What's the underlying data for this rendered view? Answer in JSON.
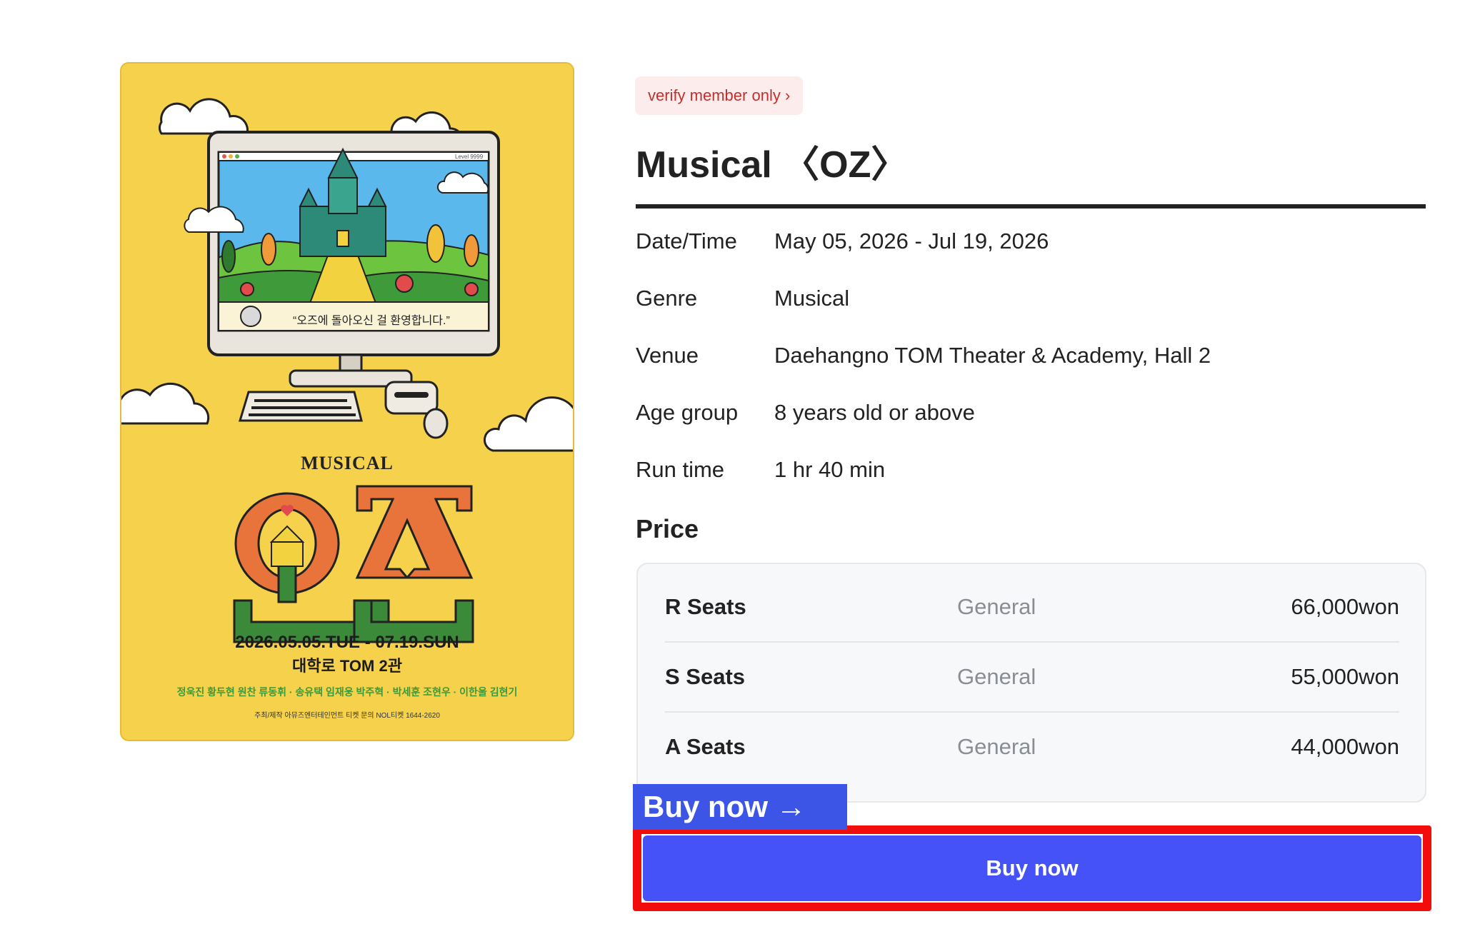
{
  "poster": {
    "musical_word": "MUSICAL",
    "logo_text": "오즈",
    "dates": "2026.05.05.TUE - 07.19.SUN",
    "venue": "대학로 TOM 2관",
    "cast": "정욱진 황두현 원찬 류동휘 · 송유택 임재웅 박주혁 · 박세훈 조현우 · 이한울 김현기",
    "credits": "주최/제작 아뮤즈엔터테인먼트  티켓 문의 NOL티켓 1644-2620",
    "screen_text": "“오즈에 돌아오신 걸 환영합니다.”",
    "screen_level": "Level 9999",
    "colors": {
      "background": "#f5d14c",
      "logo_orange": "#e8743b",
      "logo_green": "#3b8a3a"
    }
  },
  "badge": {
    "label": "verify member only ›"
  },
  "title": "Musical 〈OZ〉",
  "details": [
    {
      "label": "Date/Time",
      "value": "May 05, 2026 - Jul 19, 2026"
    },
    {
      "label": "Genre",
      "value": "Musical"
    },
    {
      "label": "Venue",
      "value": "Daehangno TOM Theater & Academy, Hall 2"
    },
    {
      "label": "Age group",
      "value": "8 years old or above"
    },
    {
      "label": "Run time",
      "value": "1 hr 40 min"
    }
  ],
  "price": {
    "heading": "Price",
    "rows": [
      {
        "seat": "R Seats",
        "type": "General",
        "amount": "66,000won"
      },
      {
        "seat": "S Seats",
        "type": "General",
        "amount": "55,000won"
      },
      {
        "seat": "A Seats",
        "type": "General",
        "amount": "44,000won"
      }
    ]
  },
  "buy": {
    "tag_label": "Buy now →",
    "button_label": "Buy now",
    "colors": {
      "button": "#4452f7",
      "highlight": "#f20d0d",
      "tag": "#3d55e6"
    }
  }
}
